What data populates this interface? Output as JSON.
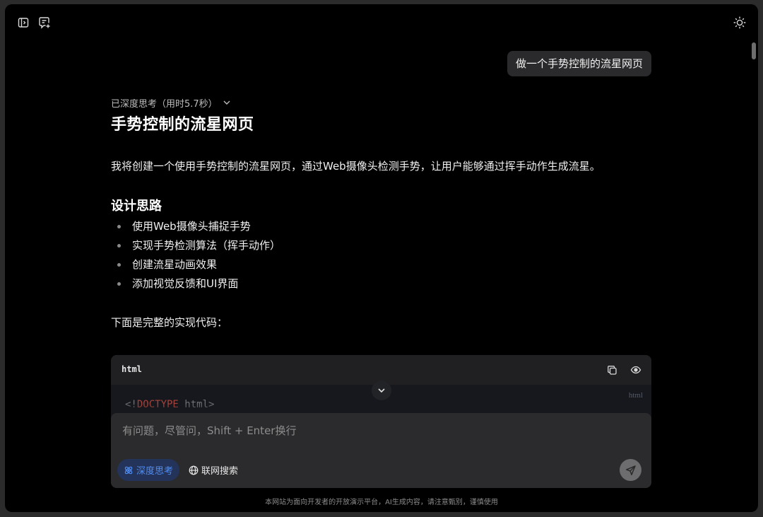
{
  "topbar": {
    "icons": [
      "sidebar-toggle-icon",
      "new-chat-icon",
      "theme-sun-icon"
    ]
  },
  "user_message": "做一个手势控制的流星网页",
  "answer": {
    "thinking_status": "已深度思考（用时5.7秒）",
    "title": "手势控制的流星网页",
    "intro": "我将创建一个使用手势控制的流星网页，通过Web摄像头检测手势，让用户能够通过挥手动作生成流星。",
    "section_title": "设计思路",
    "bullets": [
      "使用Web摄像头捕捉手势",
      "实现手势检测算法（挥手动作）",
      "创建流星动画效果",
      "添加视觉反馈和UI界面"
    ],
    "lead": "下面是完整的实现代码："
  },
  "code_block": {
    "language": "html",
    "tag": "html",
    "first_line_open": "<!",
    "first_line_keyword": "DOCTYPE",
    "first_line_rest": " html>"
  },
  "composer": {
    "placeholder": "有问题，尽管问，Shift + Enter换行",
    "value": "",
    "deep_think_label": "深度思考",
    "web_search_label": "联网搜索"
  },
  "footer": {
    "disclaimer": "本网站为面向开发者的开放演示平台，AI生成内容，请注意甄别，谨慎使用"
  },
  "colors": {
    "background": "#000000",
    "accent": "#4f8cf0",
    "bubble": "#2a2a2c",
    "composer": "#2b2b2d"
  }
}
